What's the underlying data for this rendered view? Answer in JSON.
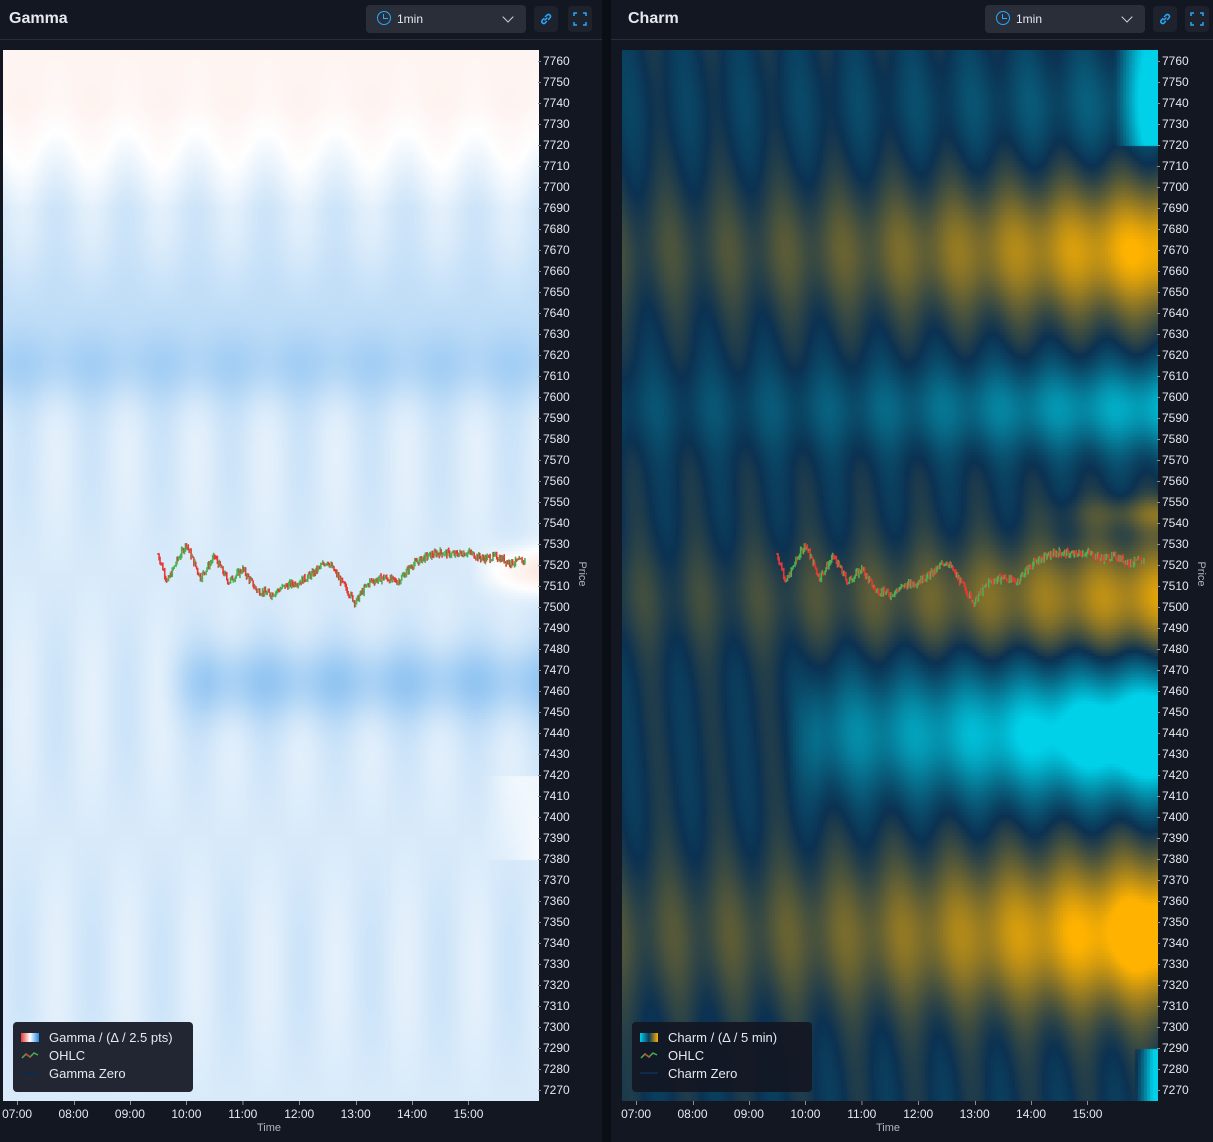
{
  "panels": [
    {
      "id": "gamma",
      "title": "Gamma",
      "timeframe": "1min",
      "legend": [
        "Gamma / (Δ / 2.5 pts)",
        "OHLC",
        "Gamma Zero"
      ],
      "colors": {
        "positive": "#f4511e",
        "negative": "#1e88e5",
        "neutral": "#ffffff",
        "candle_up": "#4caf50",
        "candle_down": "#e53935",
        "zero_line": "#0d47a1"
      }
    },
    {
      "id": "charm",
      "title": "Charm",
      "timeframe": "1min",
      "legend": [
        "Charm / (Δ / 5 min)",
        "OHLC",
        "Charm Zero"
      ],
      "colors": {
        "positive": "#ffb300",
        "negative": "#00d0e8",
        "neutral": "#0d3a5a",
        "candle_up": "#4caf50",
        "candle_down": "#e53935",
        "zero_line": "#123f63"
      }
    }
  ],
  "chart_data": [
    {
      "type": "heatmap",
      "title": "Gamma",
      "xlabel": "Time",
      "ylabel": "Price",
      "x_ticks": [
        "07:00",
        "08:00",
        "09:00",
        "10:00",
        "11:00",
        "12:00",
        "13:00",
        "14:00",
        "15:00"
      ],
      "y_ticks": [
        7760,
        7750,
        7740,
        7730,
        7720,
        7710,
        7700,
        7690,
        7680,
        7670,
        7660,
        7650,
        7640,
        7630,
        7620,
        7610,
        7600,
        7590,
        7580,
        7570,
        7560,
        7550,
        7540,
        7530,
        7520,
        7510,
        7500,
        7490,
        7480,
        7470,
        7460,
        7450,
        7440,
        7430,
        7420,
        7410,
        7400,
        7390,
        7380,
        7370,
        7360,
        7350,
        7340,
        7330,
        7320,
        7310,
        7300,
        7290,
        7280,
        7270
      ],
      "xlim": [
        "06:45",
        "16:15"
      ],
      "ylim": [
        7265,
        7765
      ],
      "legend": "bottom-left",
      "price_line": {
        "times": [
          "09:30",
          "09:40",
          "09:50",
          "10:00",
          "10:15",
          "10:30",
          "10:45",
          "11:00",
          "11:15",
          "11:30",
          "11:45",
          "12:00",
          "12:15",
          "12:30",
          "12:45",
          "13:00",
          "13:05",
          "13:15",
          "13:30",
          "13:45",
          "14:00",
          "14:15",
          "14:30",
          "14:45",
          "15:00",
          "15:15",
          "15:30",
          "15:45",
          "16:00"
        ],
        "close": [
          7525,
          7512,
          7522,
          7530,
          7514,
          7524,
          7512,
          7518,
          7508,
          7506,
          7510,
          7512,
          7516,
          7522,
          7512,
          7502,
          7506,
          7512,
          7514,
          7512,
          7520,
          7524,
          7526,
          7525,
          7526,
          7523,
          7524,
          7521,
          7522
        ]
      }
    },
    {
      "type": "heatmap",
      "title": "Charm",
      "xlabel": "Time",
      "ylabel": "Price",
      "x_ticks": [
        "07:00",
        "08:00",
        "09:00",
        "10:00",
        "11:00",
        "12:00",
        "13:00",
        "14:00",
        "15:00"
      ],
      "y_ticks": [
        7760,
        7750,
        7740,
        7730,
        7720,
        7710,
        7700,
        7690,
        7680,
        7670,
        7660,
        7650,
        7640,
        7630,
        7620,
        7610,
        7600,
        7590,
        7580,
        7570,
        7560,
        7550,
        7540,
        7530,
        7520,
        7510,
        7500,
        7490,
        7480,
        7470,
        7460,
        7450,
        7440,
        7430,
        7420,
        7410,
        7400,
        7390,
        7380,
        7370,
        7360,
        7350,
        7340,
        7330,
        7320,
        7310,
        7300,
        7290,
        7280,
        7270
      ],
      "xlim": [
        "06:45",
        "16:15"
      ],
      "ylim": [
        7265,
        7765
      ],
      "legend": "bottom-left",
      "price_line": {
        "times": [
          "09:30",
          "09:40",
          "09:50",
          "10:00",
          "10:15",
          "10:30",
          "10:45",
          "11:00",
          "11:15",
          "11:30",
          "11:45",
          "12:00",
          "12:15",
          "12:30",
          "12:45",
          "13:00",
          "13:05",
          "13:15",
          "13:30",
          "13:45",
          "14:00",
          "14:15",
          "14:30",
          "14:45",
          "15:00",
          "15:15",
          "15:30",
          "15:45",
          "16:00"
        ],
        "close": [
          7525,
          7512,
          7522,
          7530,
          7514,
          7524,
          7512,
          7518,
          7508,
          7506,
          7510,
          7512,
          7516,
          7522,
          7512,
          7502,
          7506,
          7512,
          7514,
          7512,
          7520,
          7524,
          7526,
          7525,
          7526,
          7523,
          7524,
          7521,
          7522
        ]
      }
    }
  ]
}
